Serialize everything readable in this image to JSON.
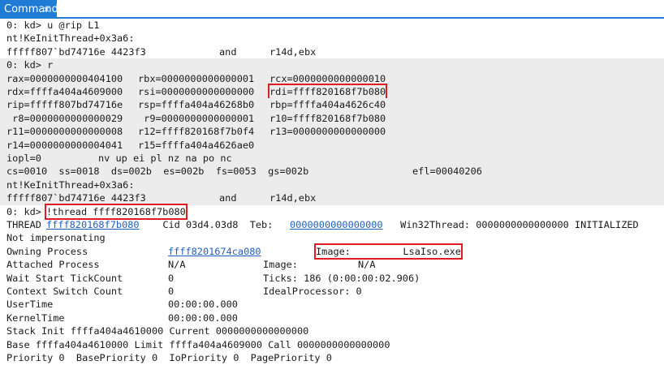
{
  "tab": {
    "label": "Command",
    "close_glyph": "×"
  },
  "lines": {
    "l0": "0: kd> u @rip L1",
    "l1": "nt!KeInitThread+0x3a6:",
    "l2a": "fffff807`bd74716e 4423f3",
    "l2b": "and",
    "l2c": "r14d,ebx",
    "l3": "0: kd> r",
    "l4a": "rax=0000000000404100",
    "l4b": "rbx=0000000000000001",
    "l4c": "rcx=0000000000000010",
    "l5a": "rdx=ffffa404a4609000",
    "l5b": "rsi=0000000000000000",
    "l5c": "rdi=ffff820168f7b080",
    "l6a": "rip=fffff807bd74716e",
    "l6b": "rsp=ffffa404a46268b0",
    "l6c": "rbp=ffffa404a4626c40",
    "l7a": " r8=0000000000000029",
    "l7b": " r9=0000000000000001",
    "l7c": "r10=ffff820168f7b080",
    "l8a": "r11=0000000000000008",
    "l8b": "r12=ffff820168f7b0f4",
    "l8c": "r13=0000000000000000",
    "l9a": "r14=0000000000004041",
    "l9b": "r15=ffffa404a4626ae0",
    "l10a": "iopl=0",
    "l10b": "nv up ei pl nz na po nc",
    "l11a": "cs=0010  ss=0018  ds=002b  es=002b  fs=0053  gs=002b",
    "l11b": "efl=00040206",
    "l12": "nt!KeInitThread+0x3a6:",
    "l13a": "fffff807`bd74716e 4423f3",
    "l13b": "and",
    "l13c": "r14d,ebx",
    "l14a": "0: kd> ",
    "l14b": "!thread ffff820168f7b080",
    "l15a": "THREAD ",
    "l15b": "ffff820168f7b080",
    "l15c": "  Cid 03d4.03d8  Teb: ",
    "l15d": "0000000000000000",
    "l15e": " Win32Thread: 0000000000000000 INITIALIZED",
    "l16": "Not impersonating",
    "l17a": "Owning Process",
    "l17b": "ffff8201674ca080",
    "l17c": "Image:         LsaIso.exe",
    "l18a": "Attached Process",
    "l18b": "N/A",
    "l18c": "Image:",
    "l18d": "N/A",
    "l19a": "Wait Start TickCount",
    "l19b": "0",
    "l19c": "Ticks: 186 (0:00:00:02.906)",
    "l20a": "Context Switch Count",
    "l20b": "0",
    "l20c": "IdealProcessor: 0",
    "l21a": "UserTime",
    "l21b": "00:00:00.000",
    "l22a": "KernelTime",
    "l22b": "00:00:00.000",
    "l23": "Stack Init ffffa404a4610000 Current 0000000000000000",
    "l24": "Base ffffa404a4610000 Limit ffffa404a4609000 Call 0000000000000000",
    "l25": "Priority 0  BasePriority 0  IoPriority 0  PagePriority 0"
  }
}
